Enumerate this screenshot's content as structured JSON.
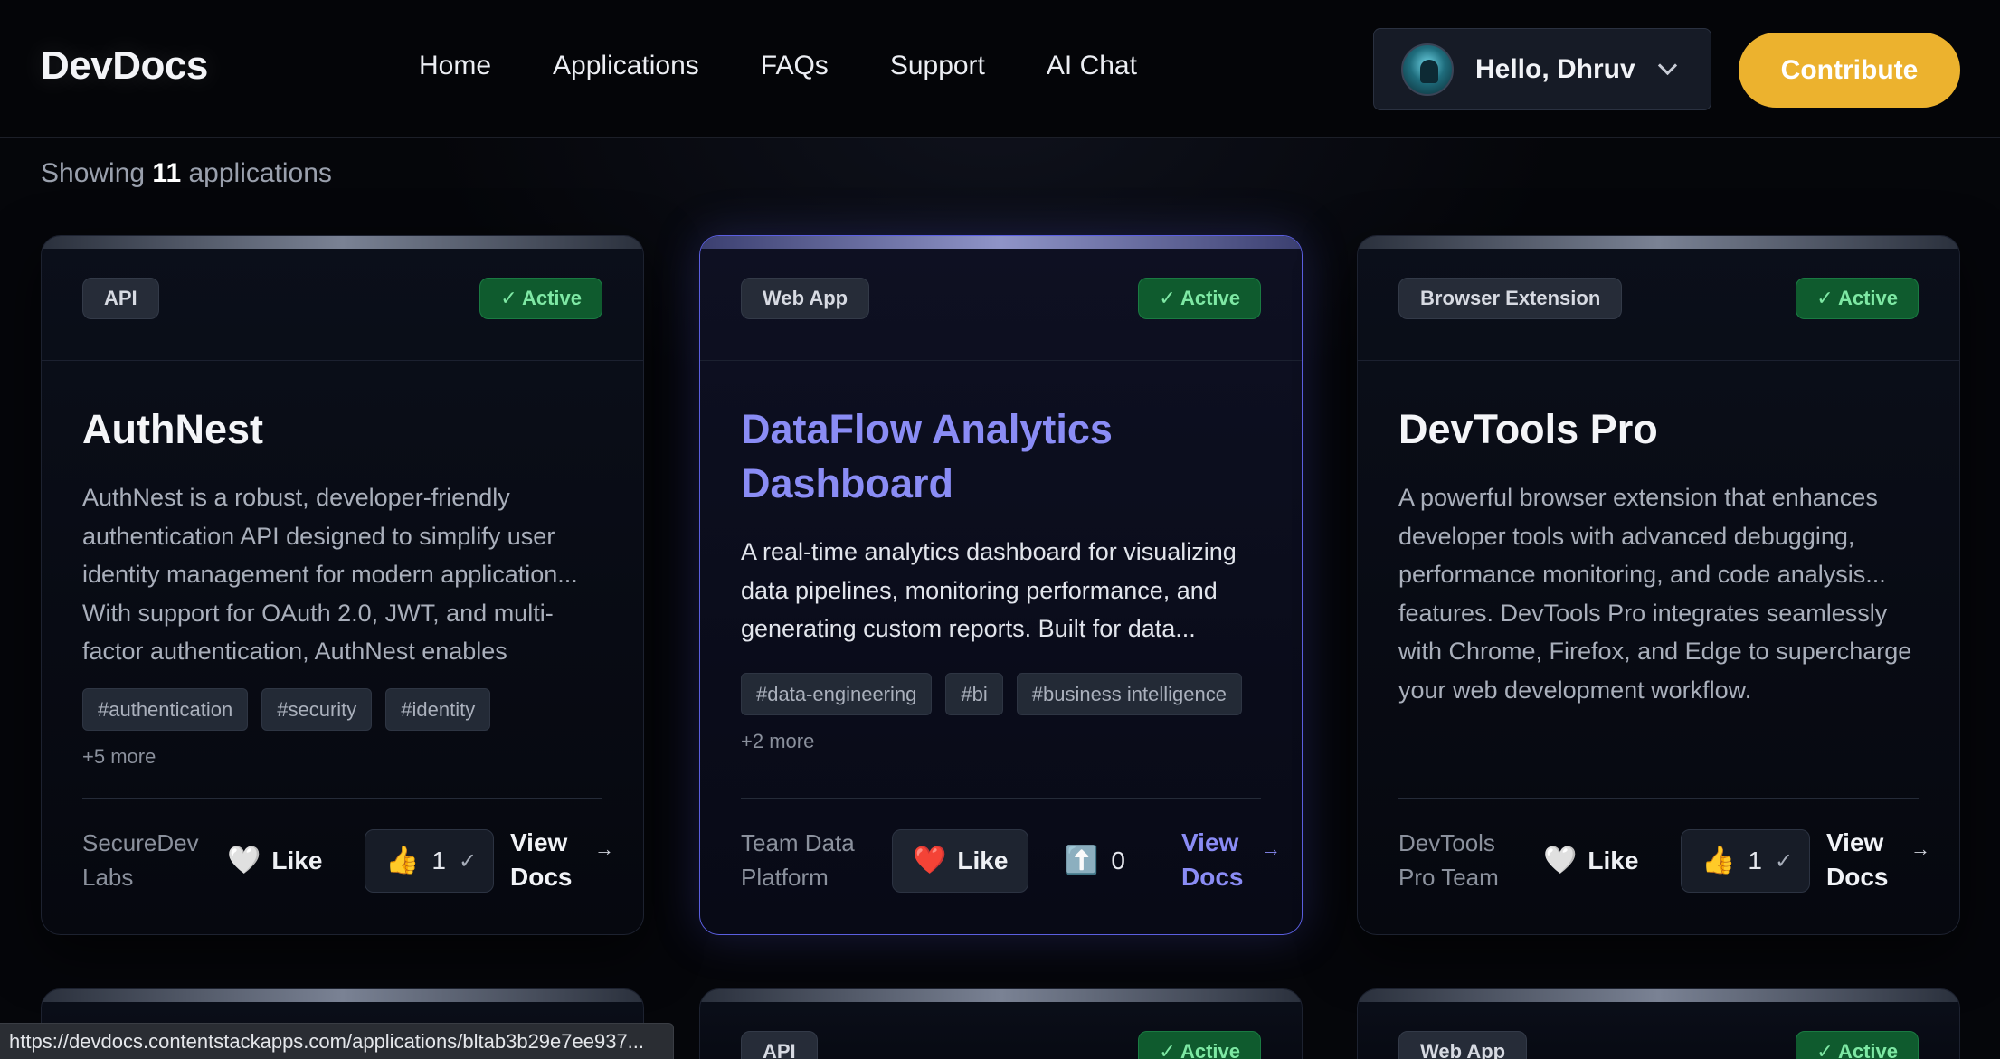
{
  "header": {
    "logo": "DevDocs",
    "nav": [
      "Home",
      "Applications",
      "FAQs",
      "Support",
      "AI Chat"
    ],
    "user_greeting": "Hello, Dhruv",
    "contribute_label": "Contribute"
  },
  "listing": {
    "showing_prefix": "Showing",
    "count": "11",
    "showing_suffix": "applications"
  },
  "cards": [
    {
      "type": "API",
      "status": "✓ Active",
      "title": "AuthNest",
      "description": "AuthNest is a robust, developer-friendly authentication API designed to simplify user identity management for modern application... With support for OAuth 2.0, JWT, and multi-factor authentication, AuthNest enables",
      "tags": [
        "#authentication",
        "#security",
        "#identity"
      ],
      "more": "+5 more",
      "author": "SecureDev Labs",
      "like_label": "Like",
      "vote_count": "1",
      "vote_check": "✓",
      "view_docs": "View Docs"
    },
    {
      "type": "Web App",
      "status": "✓ Active",
      "title": "DataFlow Analytics Dashboard",
      "description": "A real-time analytics dashboard for visualizing data pipelines, monitoring performance, and generating custom reports. Built for data...",
      "tags": [
        "#data-engineering",
        "#bi",
        "#business intelligence"
      ],
      "more": "+2 more",
      "author": "Team Data Platform",
      "like_label": "Like",
      "vote_count": "0",
      "view_docs": "View Docs"
    },
    {
      "type": "Browser Extension",
      "status": "✓ Active",
      "title": "DevTools Pro",
      "description": "A powerful browser extension that enhances developer tools with advanced debugging, performance monitoring, and code analysis... features. DevTools Pro integrates seamlessly with Chrome, Firefox, and Edge to supercharge your web development workflow.",
      "author": "DevTools Pro Team",
      "like_label": "Like",
      "vote_count": "1",
      "vote_check": "✓",
      "view_docs": "View Docs"
    }
  ],
  "peek_cards": [
    {
      "type": "",
      "status": ""
    },
    {
      "type": "API",
      "status": "✓ Active"
    },
    {
      "type": "Web App",
      "status": "✓ Active"
    }
  ],
  "statusbar_url": "https://devdocs.contentstackapps.com/applications/bltab3b29e7ee937...",
  "icons": {
    "like_empty": "white-heart-icon",
    "like_filled": "red-heart-icon",
    "thumbs_up": "thumbs-up-icon",
    "upvote": "up-arrow-icon"
  },
  "colors": {
    "accent": "#ecb22e",
    "highlight": "#8a8cf5",
    "active_badge_bg": "#0f5b2e",
    "active_badge_text": "#7ee8a4"
  }
}
